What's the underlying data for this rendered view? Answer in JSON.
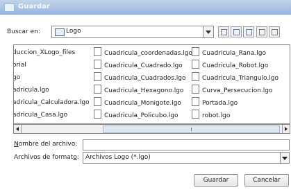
{
  "dialog": {
    "title": "Guardar"
  },
  "lookin": {
    "label": "Buscar en:",
    "value": "Logo"
  },
  "toolbar": {
    "icons": [
      "up-folder-icon",
      "home-icon",
      "new-folder-icon",
      "list-view-icon",
      "details-view-icon"
    ]
  },
  "files": [
    [
      "duccion_XLogo_files",
      "orial",
      "go",
      "adricula.lgo",
      "adricula_Calculadora.lgo",
      "adricula_Casa.lgo"
    ],
    [
      "Cuadricula_coordenadas.lgo",
      "Cuadricula_Cuadrado.lgo",
      "Cuadricula_Cuadrados.lgo",
      "Cuadricula_Hexagono.lgo",
      "Cuadricula_Monigote.lgo",
      "Cuadricula_Policubo.lgo"
    ],
    [
      "Cuadricula_Rana.lgo",
      "Cuadricula_Robot.lgo",
      "Cuadricula_Triangulo.lgo",
      "Curva_Persecucion.lgo",
      "Portada.lgo",
      "robot.lgo"
    ]
  ],
  "filename": {
    "label_mnemonic": "N",
    "label_rest": "ombre del archivo:",
    "value": ""
  },
  "filetype": {
    "label_pre": "Archivos de format",
    "label_mnemonic": "o",
    "label_post": ":",
    "value": "Archivos Logo (*.lgo)"
  },
  "buttons": {
    "save": "Guardar",
    "cancel": "Cancelar"
  }
}
